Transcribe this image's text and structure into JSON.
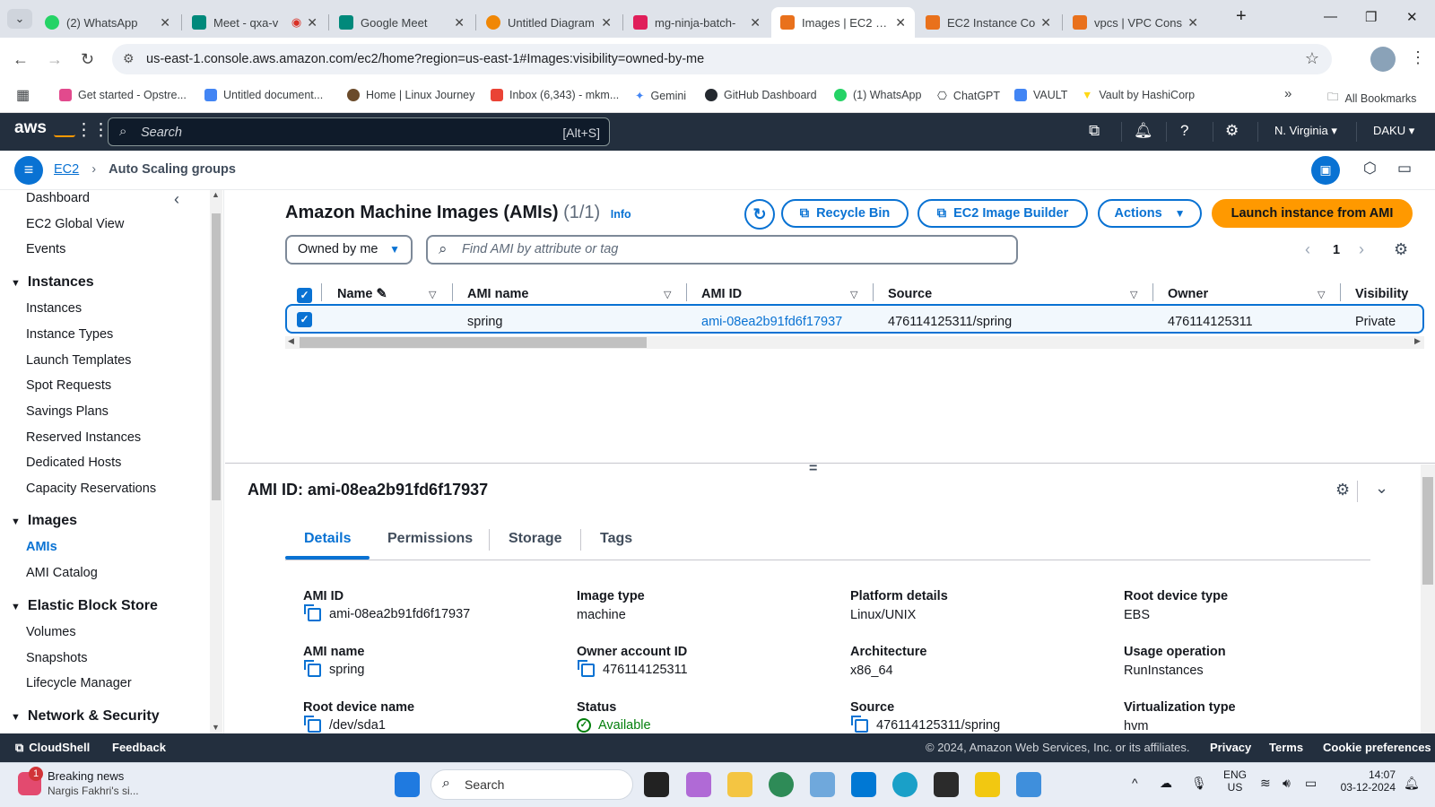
{
  "browser": {
    "tabs": [
      {
        "title": "(2) WhatsApp"
      },
      {
        "title": "Meet - qxa-v"
      },
      {
        "title": "Google Meet"
      },
      {
        "title": "Untitled Diagram"
      },
      {
        "title": "mg-ninja-batch-"
      },
      {
        "title": "Images | EC2 | us"
      },
      {
        "title": "EC2 Instance Co"
      },
      {
        "title": "vpcs | VPC Cons"
      }
    ],
    "url": "us-east-1.console.aws.amazon.com/ec2/home?region=us-east-1#Images:visibility=owned-by-me",
    "bookmarks": [
      "Get started - Opstre...",
      "Untitled document...",
      "Home | Linux Journey",
      "Inbox (6,343) - mkm...",
      "Gemini",
      "GitHub Dashboard",
      "(1) WhatsApp",
      "ChatGPT",
      "VAULT",
      "Vault by HashiCorp"
    ],
    "all_bookmarks": "All Bookmarks"
  },
  "aws": {
    "logo": "aws",
    "search_placeholder": "Search",
    "search_shortcut": "[Alt+S]",
    "region": "N. Virginia",
    "account": "DAKU"
  },
  "breadcrumb": {
    "root": "EC2",
    "current": "Auto Scaling groups"
  },
  "sidebar": {
    "top": [
      "Dashboard",
      "EC2 Global View",
      "Events"
    ],
    "instances_header": "Instances",
    "instances": [
      "Instances",
      "Instance Types",
      "Launch Templates",
      "Spot Requests",
      "Savings Plans",
      "Reserved Instances",
      "Dedicated Hosts",
      "Capacity Reservations"
    ],
    "images_header": "Images",
    "images": [
      "AMIs",
      "AMI Catalog"
    ],
    "ebs_header": "Elastic Block Store",
    "ebs": [
      "Volumes",
      "Snapshots",
      "Lifecycle Manager"
    ],
    "network_header": "Network & Security"
  },
  "list": {
    "title": "Amazon Machine Images (AMIs)",
    "count": "(1/1)",
    "info": "Info",
    "recycle_bin": "Recycle Bin",
    "image_builder": "EC2 Image Builder",
    "actions": "Actions",
    "launch": "Launch instance from AMI",
    "filter_owner": "Owned by me",
    "search_placeholder": "Find AMI by attribute or tag",
    "page": "1",
    "columns": [
      "Name",
      "AMI name",
      "AMI ID",
      "Source",
      "Owner",
      "Visibility"
    ],
    "row": {
      "name": "",
      "ami_name": "spring",
      "ami_id": "ami-08ea2b91fd6f17937",
      "source": "476114125311/spring",
      "owner": "476114125311",
      "visibility": "Private"
    }
  },
  "detail": {
    "heading": "AMI ID: ami-08ea2b91fd6f17937",
    "tabs": [
      "Details",
      "Permissions",
      "Storage",
      "Tags"
    ],
    "fields": [
      {
        "label": "AMI ID",
        "value": "ami-08ea2b91fd6f17937"
      },
      {
        "label": "Image type",
        "value": "machine"
      },
      {
        "label": "Platform details",
        "value": "Linux/UNIX"
      },
      {
        "label": "Root device type",
        "value": "EBS"
      },
      {
        "label": "AMI name",
        "value": "spring"
      },
      {
        "label": "Owner account ID",
        "value": "476114125311"
      },
      {
        "label": "Architecture",
        "value": "x86_64"
      },
      {
        "label": "Usage operation",
        "value": "RunInstances"
      },
      {
        "label": "Root device name",
        "value": "/dev/sda1"
      },
      {
        "label": "Status",
        "value": "Available"
      },
      {
        "label": "Source",
        "value": "476114125311/spring"
      },
      {
        "label": "Virtualization type",
        "value": "hvm"
      }
    ]
  },
  "footer": {
    "cloudshell": "CloudShell",
    "feedback": "Feedback",
    "copyright": "© 2024, Amazon Web Services, Inc. or its affiliates.",
    "privacy": "Privacy",
    "terms": "Terms",
    "cookies": "Cookie preferences"
  },
  "taskbar": {
    "news_title": "Breaking news",
    "news_sub": "Nargis Fakhri's si...",
    "news_badge": "1",
    "search": "Search",
    "lang1": "ENG",
    "lang2": "US",
    "time": "14:07",
    "date": "03-12-2024"
  },
  "colors": {
    "accent": "#0972d3",
    "launch": "#ff9900",
    "header": "#232f3e",
    "success": "#037f0c"
  }
}
